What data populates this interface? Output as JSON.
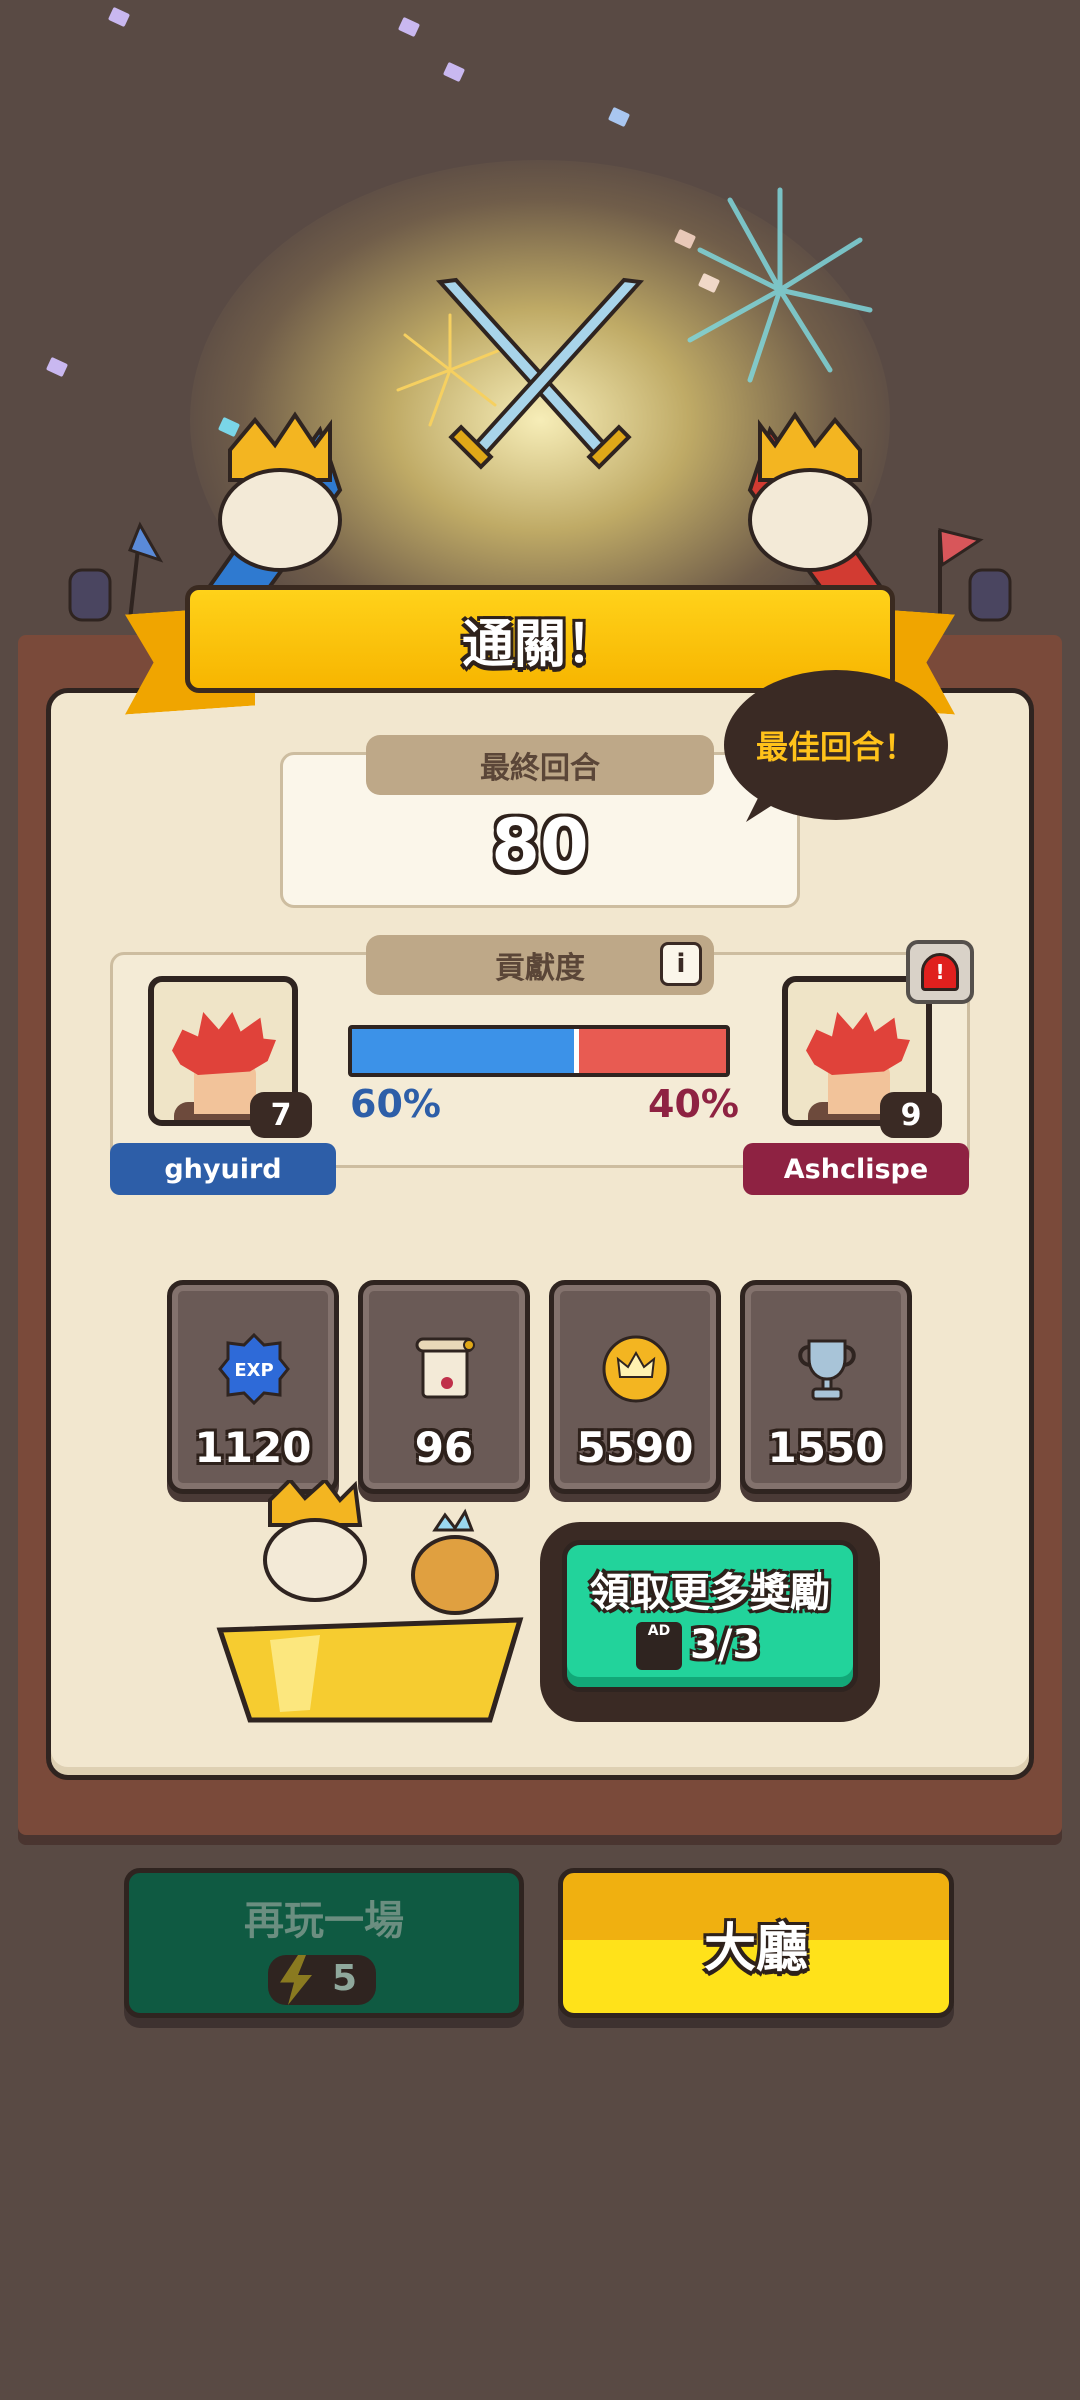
{
  "banner": {
    "title": "通關！"
  },
  "final_round": {
    "label": "最終回合",
    "value": "80",
    "best_badge": "最佳回合！"
  },
  "contribution": {
    "label": "貢獻度",
    "info_icon": "info-icon",
    "left_player": {
      "name": "ghyuird",
      "level": "7",
      "percent_text": "60%",
      "share": 0.6,
      "color": "#2d5ea8"
    },
    "right_player": {
      "name": "Ashclispe",
      "level": "9",
      "percent_text": "40%",
      "share": 0.4,
      "color": "#8e2242"
    },
    "bar_colors": {
      "left": "#3c92e8",
      "right": "#e85b52"
    },
    "report_icon": "siren-alarm-icon"
  },
  "rewards": [
    {
      "icon": "exp-badge-icon",
      "value": "1120"
    },
    {
      "icon": "scroll-icon",
      "value": "96"
    },
    {
      "icon": "crown-coin-icon",
      "value": "5590"
    },
    {
      "icon": "trophy-icon",
      "value": "1550"
    }
  ],
  "claim_more": {
    "label": "領取更多獎勵",
    "ad_icon_text": "AD",
    "count": "3/3",
    "color": "#22d39b"
  },
  "buttons": {
    "play_again": {
      "label": "再玩一場",
      "energy_cost": "5"
    },
    "lobby": {
      "label": "大廳"
    }
  }
}
